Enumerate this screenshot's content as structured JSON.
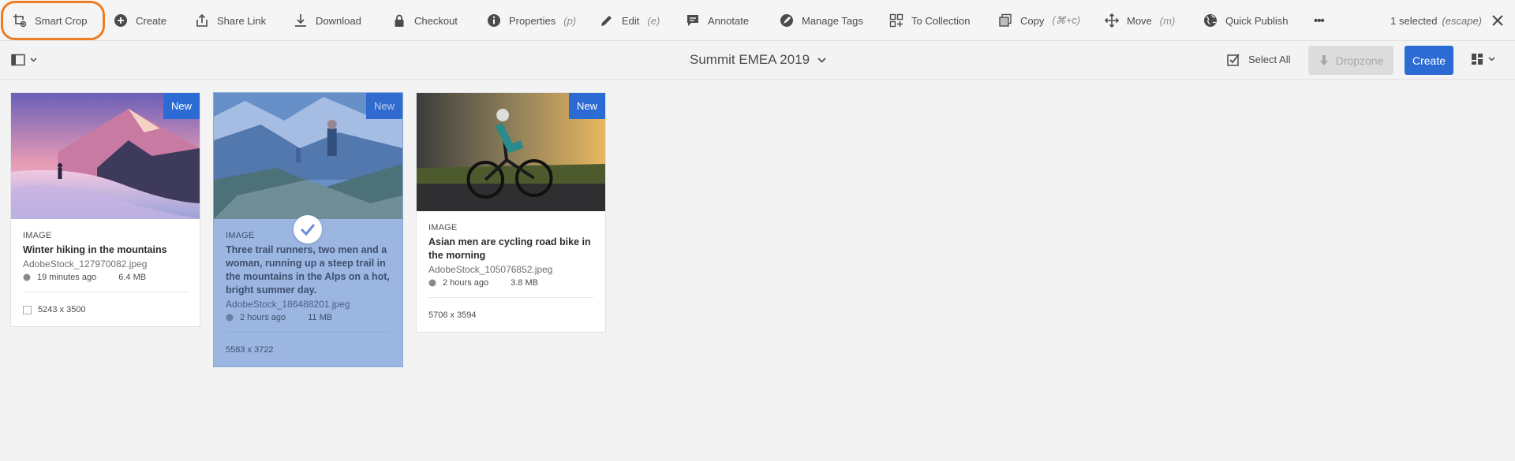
{
  "actionbar": {
    "actions": [
      {
        "label": "Smart Crop",
        "icon": "smart-crop-icon"
      },
      {
        "label": "Create",
        "icon": "add-circle-icon"
      },
      {
        "label": "Share Link",
        "icon": "share-icon"
      },
      {
        "label": "Download",
        "icon": "download-icon"
      },
      {
        "label": "Checkout",
        "icon": "lock-icon"
      },
      {
        "label": "Properties",
        "hint": "(p)",
        "icon": "info-icon"
      },
      {
        "label": "Edit",
        "hint": "(e)",
        "icon": "pencil-icon"
      },
      {
        "label": "Annotate",
        "icon": "comment-icon"
      },
      {
        "label": "Manage Tags",
        "icon": "tag-icon"
      },
      {
        "label": "To Collection",
        "icon": "collection-add-icon"
      },
      {
        "label": "Copy",
        "hint": "(⌘+c)",
        "icon": "copy-icon"
      },
      {
        "label": "Move",
        "hint": "(m)",
        "icon": "move-icon"
      },
      {
        "label": "Quick Publish",
        "icon": "globe-icon"
      },
      {
        "label": "•••",
        "icon": "more-icon"
      }
    ],
    "selected_text": "1 selected",
    "selected_hint": "(escape)",
    "highlight_color": "#ee7c22"
  },
  "toolbar": {
    "folder_title": "Summit EMEA 2019",
    "select_all": "Select All",
    "dropzone": "Dropzone",
    "create": "Create",
    "accent": "#2d6bd4"
  },
  "cards": [
    {
      "badge": "New",
      "type": "IMAGE",
      "title": "Winter hiking in the mountains",
      "file": "AdobeStock_127970082.jpeg",
      "time": "19 minutes ago",
      "size": "6.4 MB",
      "dims": "5243 x 3500",
      "selected": false
    },
    {
      "badge": "New",
      "type": "IMAGE",
      "title": "Three trail runners, two men and a woman, running up a steep trail in the mountains in the Alps on a hot, bright summer day.",
      "file": "AdobeStock_186488201.jpeg",
      "time": "2 hours ago",
      "size": "11 MB",
      "dims": "5583 x 3722",
      "selected": true
    },
    {
      "badge": "New",
      "type": "IMAGE",
      "title": "Asian men are cycling road bike in the morning",
      "file": "AdobeStock_105076852.jpeg",
      "time": "2 hours ago",
      "size": "3.8 MB",
      "dims": "5706 x 3594",
      "selected": false
    }
  ]
}
